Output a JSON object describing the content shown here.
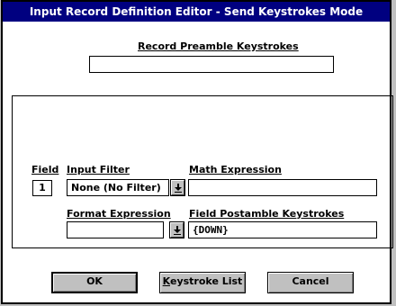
{
  "window": {
    "title": "Input Record Definition Editor - Send Keystrokes Mode"
  },
  "preamble": {
    "label": "Record Preamble Keystrokes",
    "value": ""
  },
  "field": {
    "label": "Field",
    "number": "1",
    "input_filter_label": "Input Filter",
    "input_filter_value": "None (No Filter)",
    "math_expression_label": "Math Expression",
    "math_expression_value": "",
    "format_expression_label": "Format Expression",
    "format_expression_value": "",
    "postamble_label": "Field Postamble Keystrokes",
    "postamble_value": "{DOWN}"
  },
  "buttons": {
    "ok": "OK",
    "keystroke_list_first": "K",
    "keystroke_list_rest": "eystroke List",
    "cancel": "Cancel"
  },
  "icons": {
    "dropdown": "down-arrow-icon"
  }
}
